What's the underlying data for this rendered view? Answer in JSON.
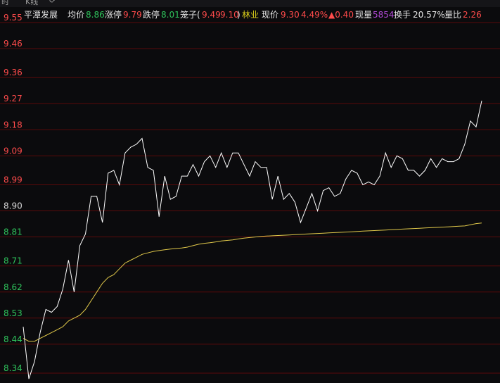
{
  "tabs": [
    {
      "label": "时"
    },
    {
      "label": "K线"
    }
  ],
  "info": {
    "name": "平潭发展",
    "avg_label": "均价",
    "avg": "8.86",
    "limit_up_label": "涨停",
    "limit_up": "9.79",
    "limit_down_label": "跌停",
    "limit_down": "8.01",
    "basket_label": "笼子(",
    "basket_low": "9.49",
    "basket_high": "9.10",
    "basket_close": ")",
    "sector": "林业",
    "price_label": "现价",
    "price": "9.30",
    "pct": "4.49%",
    "change": "▲0.40",
    "vol_label": "现量",
    "vol": "5854",
    "turnover_label": "换手",
    "turnover": "20.57%",
    "ratio_label": "量比",
    "ratio": "2.26"
  },
  "colors": {
    "up": "#ff4b4b",
    "down": "#2ec25b",
    "price_line": "#ffffff",
    "avg_line": "#e0c84a",
    "grid": "#5a0a0a"
  },
  "chart_data": {
    "type": "line",
    "ylim": [
      8.3,
      9.55
    ],
    "yticks": [
      {
        "label": "9.55",
        "v": 9.55,
        "side": "up"
      },
      {
        "label": "9.46",
        "v": 9.46,
        "side": "up"
      },
      {
        "label": "9.36",
        "v": 9.36,
        "side": "up"
      },
      {
        "label": "9.27",
        "v": 9.27,
        "side": "up"
      },
      {
        "label": "9.18",
        "v": 9.18,
        "side": "up"
      },
      {
        "label": "9.09",
        "v": 9.09,
        "side": "up"
      },
      {
        "label": "8.99",
        "v": 8.99,
        "side": "up"
      },
      {
        "label": "8.90",
        "v": 8.9,
        "side": "flat"
      },
      {
        "label": "8.81",
        "v": 8.81,
        "side": "down"
      },
      {
        "label": "8.71",
        "v": 8.71,
        "side": "down"
      },
      {
        "label": "8.62",
        "v": 8.62,
        "side": "down"
      },
      {
        "label": "8.53",
        "v": 8.53,
        "side": "down"
      },
      {
        "label": "8.44",
        "v": 8.44,
        "side": "down"
      },
      {
        "label": "8.34",
        "v": 8.34,
        "side": "down"
      }
    ],
    "series": [
      {
        "values": [
          8.5,
          8.32,
          8.38,
          8.48,
          8.56,
          8.55,
          8.57,
          8.63,
          8.73,
          8.62,
          8.78,
          8.82,
          8.95,
          8.95,
          8.86,
          9.03,
          9.04,
          8.99,
          9.1,
          9.12,
          9.13,
          9.15,
          9.05,
          9.04,
          8.88,
          9.02,
          8.94,
          8.95,
          9.02,
          9.02,
          9.06,
          9.02,
          9.07,
          9.09,
          9.05,
          9.1,
          9.05,
          9.1,
          9.1,
          9.06,
          9.02,
          9.07,
          9.05,
          9.05,
          8.94,
          9.02,
          8.94,
          8.96,
          8.93,
          8.86,
          8.91,
          8.96,
          8.9,
          8.97,
          8.98,
          8.95,
          8.96,
          9.01,
          9.04,
          9.03,
          8.99,
          9.0,
          8.99,
          9.02,
          9.1,
          9.05,
          9.09,
          9.08,
          9.04,
          9.04,
          9.02,
          9.04,
          9.08,
          9.05,
          9.08,
          9.07,
          9.07,
          9.08,
          9.13,
          9.21,
          9.19,
          9.28
        ]
      },
      {
        "values": [
          8.46,
          8.45,
          8.45,
          8.46,
          8.47,
          8.48,
          8.49,
          8.5,
          8.52,
          8.53,
          8.54,
          8.56,
          8.59,
          8.62,
          8.65,
          8.67,
          8.68,
          8.7,
          8.72,
          8.73,
          8.74,
          8.75,
          8.755,
          8.76,
          8.763,
          8.766,
          8.768,
          8.77,
          8.772,
          8.775,
          8.78,
          8.785,
          8.788,
          8.79,
          8.793,
          8.796,
          8.798,
          8.8,
          8.803,
          8.806,
          8.808,
          8.81,
          8.812,
          8.813,
          8.814,
          8.815,
          8.816,
          8.817,
          8.818,
          8.819,
          8.82,
          8.821,
          8.822,
          8.823,
          8.824,
          8.825,
          8.826,
          8.827,
          8.828,
          8.829,
          8.83,
          8.831,
          8.832,
          8.833,
          8.834,
          8.835,
          8.836,
          8.837,
          8.838,
          8.839,
          8.84,
          8.841,
          8.842,
          8.843,
          8.844,
          8.845,
          8.846,
          8.847,
          8.848,
          8.852,
          8.856,
          8.858
        ]
      }
    ]
  }
}
